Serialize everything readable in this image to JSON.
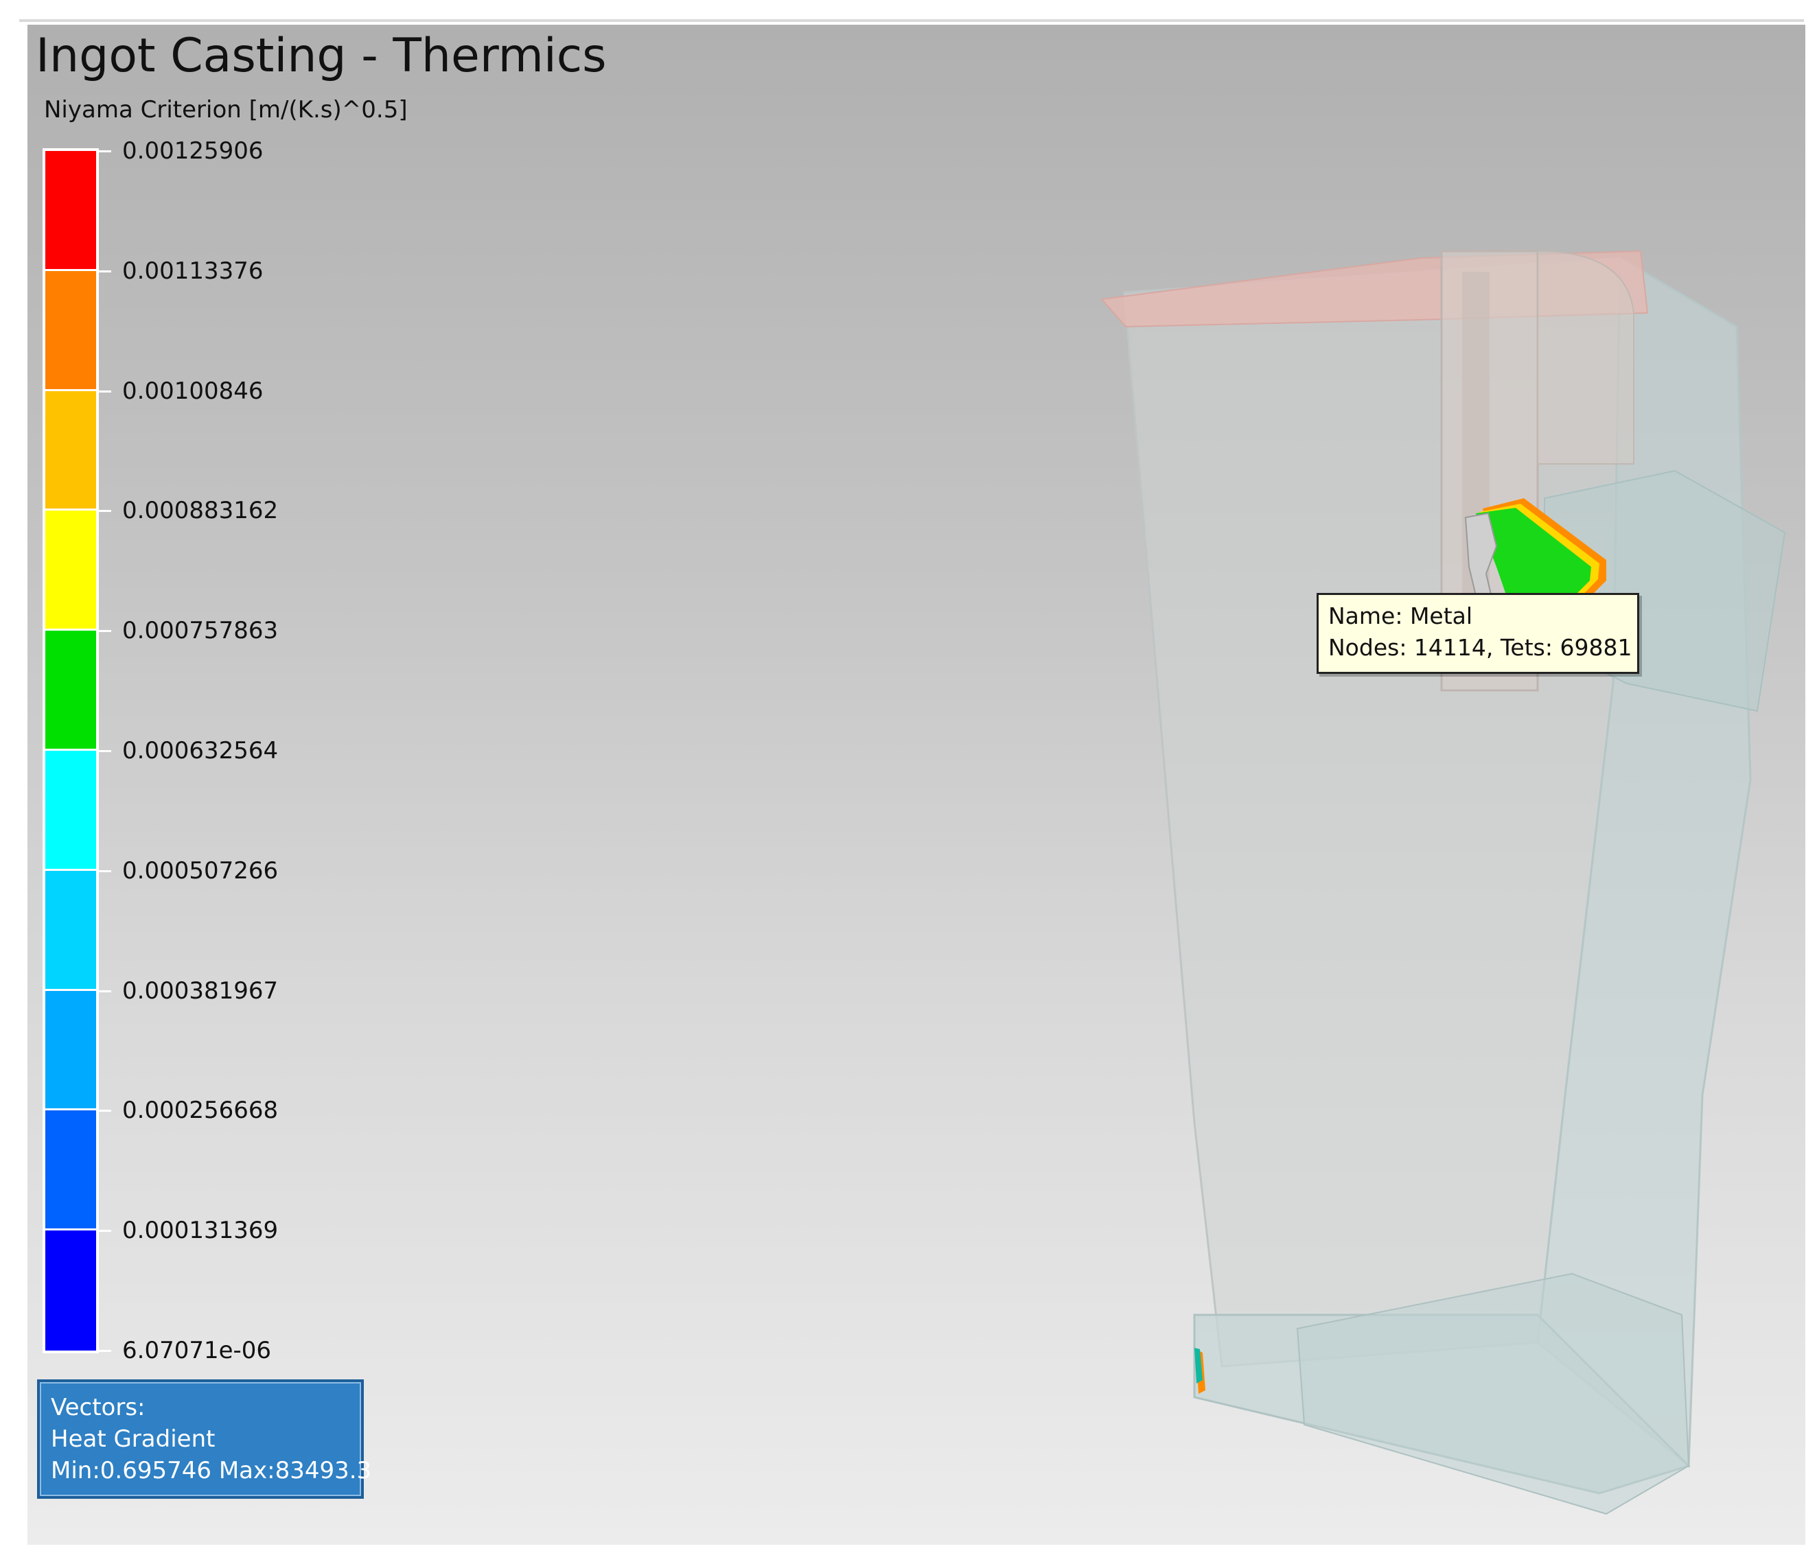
{
  "title": "Ingot Casting - Thermics",
  "legend": {
    "title": "Niyama Criterion  [m/(K.s)^0.5]",
    "bands": [
      {
        "color": "#ff0000"
      },
      {
        "color": "#ff7f00"
      },
      {
        "color": "#ffc200"
      },
      {
        "color": "#ffff00"
      },
      {
        "color": "#00e000"
      },
      {
        "color": "#00ffff"
      },
      {
        "color": "#00d4ff"
      },
      {
        "color": "#00aaff"
      },
      {
        "color": "#0062ff"
      },
      {
        "color": "#0000ff"
      }
    ],
    "ticks": [
      "0.00125906",
      "0.00113376",
      "0.00100846",
      "0.000883162",
      "0.000757863",
      "0.000632564",
      "0.000507266",
      "0.000381967",
      "0.000256668",
      "0.000131369",
      "6.07071e-06"
    ]
  },
  "vectors": {
    "label": "Vectors:",
    "name": "Heat Gradient",
    "range": "Min:0.695746 Max:83493.3"
  },
  "tooltip": {
    "name": "Name: Metal",
    "stats": "Nodes: 14114, Tets: 69881"
  },
  "colors": {
    "viewport_top": "#b0b0b0",
    "viewport_bottom": "#ececec",
    "vectors_box": "#2f80c4",
    "tooltip_bg": "#ffffe1"
  }
}
